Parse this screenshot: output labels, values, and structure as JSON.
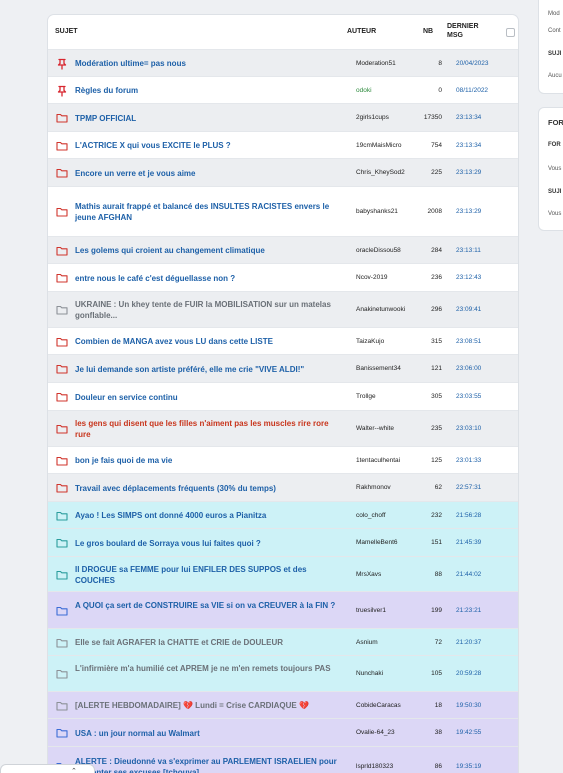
{
  "header": {
    "subject": "SUJET",
    "author": "AUTEUR",
    "nb": "NB",
    "last_msg_line1": "DERNIER",
    "last_msg_line2": "MSG"
  },
  "colors": {
    "pinned": "#d8262f",
    "folder_red": "#d0342c",
    "folder_grey": "#8c9197",
    "folder_teal": "#2a9d9d",
    "folder_blue": "#3b6cd6",
    "title_blue": "#1d60a8",
    "title_grey": "#6a7077",
    "title_red": "#c8351c",
    "bg_teal": "#cdf2f7",
    "bg_lavender": "#dcd7f6",
    "bg_grey": "#eceef1",
    "author_green": "#2e8b3e"
  },
  "topics": [
    {
      "title": "Modération ultime= pas nous",
      "author": "Moderation51",
      "nb": "8",
      "last": "20/04/2023",
      "icon": "pin-icon",
      "bg": "grey",
      "title_color": "blue",
      "author_color": "default"
    },
    {
      "title": "Règles du forum",
      "author": "odoki",
      "nb": "0",
      "last": "08/11/2022",
      "icon": "pin-icon",
      "bg": "white",
      "title_color": "blue",
      "author_color": "green"
    },
    {
      "title": "TPMP OFFICIAL",
      "author": "2girls1cups",
      "nb": "17350",
      "last": "23:13:34",
      "icon": "folder-red-icon",
      "bg": "grey",
      "title_color": "blue",
      "author_color": "default"
    },
    {
      "title": "L'ACTRICE X qui vous EXCITE le PLUS ?",
      "author": "19cmMaisMicro",
      "nb": "754",
      "last": "23:13:34",
      "icon": "folder-red-icon",
      "bg": "white",
      "title_color": "blue",
      "author_color": "default"
    },
    {
      "title": "Encore un verre et je vous aime",
      "author": "Chris_KheySod2",
      "nb": "225",
      "last": "23:13:29",
      "icon": "folder-red-icon",
      "bg": "grey",
      "title_color": "blue",
      "author_color": "default"
    },
    {
      "title": "Mathis aurait frappé et balancé des INSULTES RACISTES envers le jeune AFGHAN",
      "author": "babyshanks21",
      "nb": "2008",
      "last": "23:13:29",
      "icon": "folder-red-icon",
      "bg": "white",
      "title_color": "blue",
      "author_color": "default"
    },
    {
      "title": "Les golems qui croient au changement climatique",
      "author": "oracleDissou58",
      "nb": "284",
      "last": "23:13:11",
      "icon": "folder-red-icon",
      "bg": "grey",
      "title_color": "blue",
      "author_color": "default"
    },
    {
      "title": "entre nous le café c'est déguellasse non ?",
      "author": "Ncov-2019",
      "nb": "236",
      "last": "23:12:43",
      "icon": "folder-red-icon",
      "bg": "white",
      "title_color": "blue",
      "author_color": "default"
    },
    {
      "title": "UKRAINE : Un khey tente de FUIR la MOBILISATION sur un matelas gonflable...",
      "author": "Anakinetunwooki",
      "nb": "296",
      "last": "23:09:41",
      "icon": "folder-grey-icon",
      "bg": "grey",
      "title_color": "grey",
      "author_color": "default"
    },
    {
      "title": "Combien de MANGA avez vous LU dans cette LISTE",
      "author": "TaizaKujo",
      "nb": "315",
      "last": "23:08:51",
      "icon": "folder-red-icon",
      "bg": "white",
      "title_color": "blue",
      "author_color": "default"
    },
    {
      "title": "Je lui demande son artiste préféré, elle me crie \"VIVE ALDI!\"",
      "author": "Banissement34",
      "nb": "121",
      "last": "23:06:00",
      "icon": "folder-red-icon",
      "bg": "grey",
      "title_color": "blue",
      "author_color": "default"
    },
    {
      "title": "Douleur en service continu",
      "author": "Trollge",
      "nb": "305",
      "last": "23:03:55",
      "icon": "folder-red-icon",
      "bg": "white",
      "title_color": "blue",
      "author_color": "default"
    },
    {
      "title": "les gens qui disent que les filles n'aiment pas les muscles rire rore rure",
      "author": "Walter--white",
      "nb": "235",
      "last": "23:03:10",
      "icon": "folder-red-icon",
      "bg": "grey",
      "title_color": "red",
      "author_color": "default"
    },
    {
      "title": "bon je fais quoi de ma vie",
      "author": "1tentaculhentai",
      "nb": "125",
      "last": "23:01:33",
      "icon": "folder-red-icon",
      "bg": "white",
      "title_color": "blue",
      "author_color": "default"
    },
    {
      "title": "Travail avec déplacements fréquents (30% du temps)",
      "author": "Rakhmonov",
      "nb": "62",
      "last": "22:57:31",
      "icon": "folder-red-icon",
      "bg": "grey",
      "title_color": "blue",
      "author_color": "default"
    },
    {
      "title": "Ayao ! Les SIMPS ont donné 4000 euros a Pianitza",
      "author": "colo_choff",
      "nb": "232",
      "last": "21:56:28",
      "icon": "folder-teal-icon",
      "bg": "teal",
      "title_color": "blue",
      "author_color": "default"
    },
    {
      "title": "Le gros boulard de Sorraya vous lui faites quoi ?",
      "author": "MamelleBent6",
      "nb": "151",
      "last": "21:45:39",
      "icon": "folder-teal-icon",
      "bg": "teal",
      "title_color": "blue",
      "author_color": "default"
    },
    {
      "title": "Il DROGUE sa FEMME pour lui ENFILER DES SUPPOS et des COUCHES",
      "author": "MrsXavs",
      "nb": "88",
      "last": "21:44:02",
      "icon": "folder-teal-icon",
      "bg": "teal",
      "title_color": "blue",
      "author_color": "default"
    },
    {
      "title": "A QUOI ça sert de CONSTRUIRE sa VIE si on va CREUVER à la FIN ?",
      "author": "truesilver1",
      "nb": "199",
      "last": "21:23:21",
      "icon": "folder-blue-icon",
      "bg": "lavender",
      "title_color": "blue",
      "author_color": "default"
    },
    {
      "title": "Elle se fait AGRAFER la CHATTE et CRIE de DOULEUR",
      "author": "Asnium",
      "nb": "72",
      "last": "21:20:37",
      "icon": "folder-grey-icon",
      "bg": "teal",
      "title_color": "grey",
      "author_color": "default"
    },
    {
      "title": "L'infirmière m'a humilié cet APREM je ne m'en remets toujours PAS",
      "author": "Nunchaki",
      "nb": "105",
      "last": "20:59:28",
      "icon": "folder-grey-icon",
      "bg": "teal",
      "title_color": "grey",
      "author_color": "default"
    },
    {
      "title": "[ALERTE HEBDOMADAIRE] 💔 Lundi = Crise CARDIAQUE 💔",
      "author": "CobideCaracas",
      "nb": "18",
      "last": "19:50:30",
      "icon": "folder-grey-icon",
      "bg": "lavender",
      "title_color": "grey",
      "author_color": "default"
    },
    {
      "title": "USA : un jour normal au Walmart",
      "author": "Ovalie-64_23",
      "nb": "38",
      "last": "19:42:55",
      "icon": "folder-blue-icon",
      "bg": "lavender",
      "title_color": "blue",
      "author_color": "default"
    },
    {
      "title": "ALERTE : Dieudonné va s'exprimer au PARLEMENT ISRAELIEN pour présenter ses excuses [tchouva]",
      "author": "lsprld180323",
      "nb": "86",
      "last": "19:35:19",
      "icon": "folder-blue-icon",
      "bg": "lavender",
      "title_color": "blue",
      "author_color": "default"
    }
  ],
  "right_panel_top": {
    "lines": [
      "Mod",
      "Cont",
      "SUJI",
      "Aucu"
    ]
  },
  "right_panel_mid": {
    "heading": "FOR",
    "lines": [
      "FOR",
      "Vous",
      "SUJI",
      "Vous"
    ]
  }
}
